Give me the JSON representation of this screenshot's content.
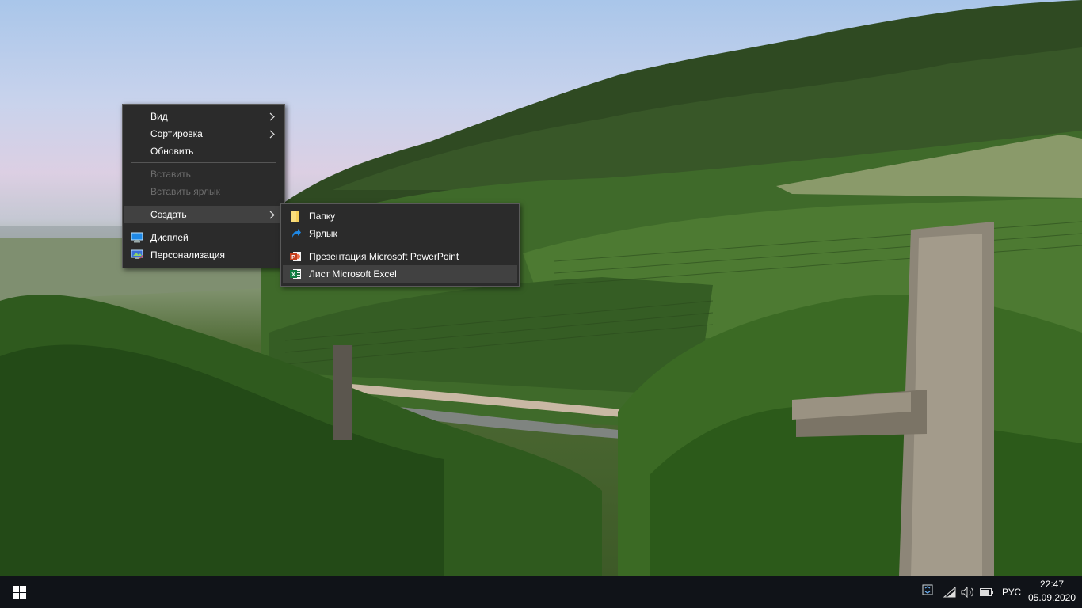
{
  "desktop": {
    "context_menu": {
      "items": [
        {
          "label": "Вид"
        },
        {
          "label": "Сортировка"
        },
        {
          "label": "Обновить"
        },
        {
          "label": "Вставить"
        },
        {
          "label": "Вставить ярлык"
        },
        {
          "label": "Создать"
        },
        {
          "label": "Дисплей"
        },
        {
          "label": "Персонализация"
        }
      ]
    },
    "submenu": {
      "items": [
        {
          "label": "Папку"
        },
        {
          "label": "Ярлык"
        },
        {
          "label": "Презентация Microsoft PowerPoint"
        },
        {
          "label": "Лист Microsoft Excel"
        }
      ]
    }
  },
  "taskbar": {
    "language": "РУС",
    "time": "22:47",
    "date": "05.09.2020"
  },
  "colors": {
    "menu_bg": "#2b2b2b",
    "menu_hover": "#414141",
    "disabled_text": "#6d6d6d",
    "taskbar_bg": "#101318"
  }
}
